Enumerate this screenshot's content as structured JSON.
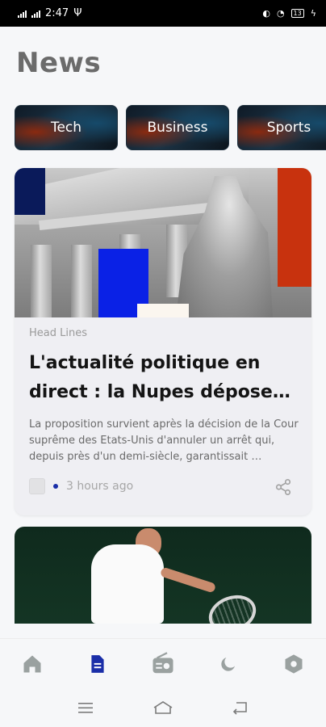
{
  "status_bar": {
    "time": "2:47",
    "battery": "13",
    "icons": [
      "signal-icon",
      "signal-icon",
      "usb-icon",
      "vpn-icon",
      "wifi-icon",
      "battery-icon"
    ]
  },
  "header": {
    "title": "News"
  },
  "categories": [
    {
      "label": "Tech"
    },
    {
      "label": "Business"
    },
    {
      "label": "Sports"
    }
  ],
  "articles": [
    {
      "kicker": "Head Lines",
      "headline": "L'actualité politique en direct : la Nupes dépose…",
      "summary": "La proposition survient après la décision de la Cour suprême des Etats-Unis d'annuler un arrêt qui, depuis près d'un demi-siècle, garantissait …",
      "time": "3 hours ago",
      "icon": "share-icon"
    }
  ],
  "bottom_nav": {
    "items": [
      {
        "icon": "home-icon",
        "active": false
      },
      {
        "icon": "article-icon",
        "active": true
      },
      {
        "icon": "radio-icon",
        "active": false
      },
      {
        "icon": "moon-icon",
        "active": false
      },
      {
        "icon": "settings-icon",
        "active": false
      }
    ],
    "active_color": "#1a2ea8",
    "inactive_color": "#9aa1a0"
  },
  "system_nav": {
    "icons": [
      "menu-icon",
      "home-outline-icon",
      "back-icon"
    ]
  }
}
